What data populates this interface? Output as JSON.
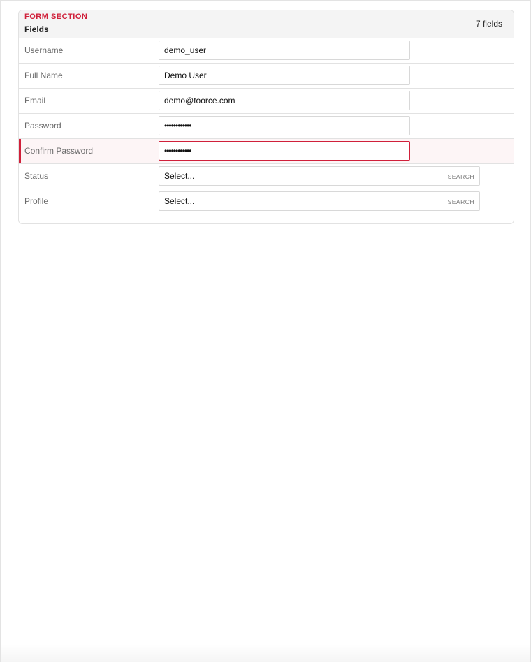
{
  "section": {
    "label": "FORM SECTION",
    "title": "Fields",
    "count": "7 fields"
  },
  "fields": [
    {
      "label": "Username",
      "value": "demo_user"
    },
    {
      "label": "Full Name",
      "value": "Demo User"
    },
    {
      "label": "Email",
      "value": "demo@toorce.com"
    },
    {
      "label": "Password",
      "value": "••••••••••••"
    },
    {
      "label": "Confirm Password",
      "value": "••••••••••••"
    },
    {
      "label": "Status",
      "value": "Select...",
      "action": "SEARCH"
    },
    {
      "label": "Profile",
      "value": "Select...",
      "action": "SEARCH"
    }
  ],
  "colors": {
    "accent": "#d0203a",
    "header_bg": "#f4f4f4",
    "invalid_row_bg": "#fdf5f6"
  }
}
